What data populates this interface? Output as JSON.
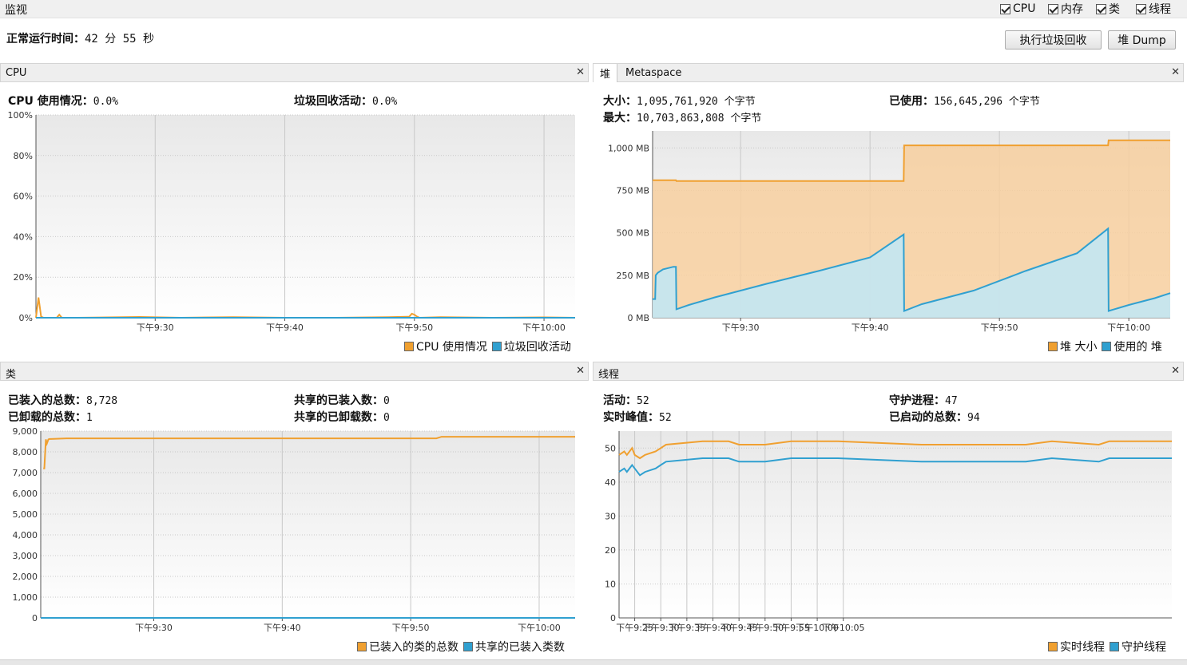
{
  "window": {
    "title": "监视"
  },
  "checkboxes": [
    {
      "label": "CPU",
      "checked": true
    },
    {
      "label": "内存",
      "checked": true
    },
    {
      "label": "类",
      "checked": true
    },
    {
      "label": "线程",
      "checked": true
    }
  ],
  "uptime": {
    "label": "正常运行时间：",
    "value": "42 分 55 秒"
  },
  "buttons": {
    "gc": "执行垃圾回收",
    "heap_dump": "堆 Dump"
  },
  "colors": {
    "orange": "#f0a030",
    "blue": "#30a0d0",
    "panel_bg": "#f5f5f5"
  },
  "panels": {
    "cpu": {
      "title": "CPU",
      "stats": [
        {
          "label": "CPU 使用情况：",
          "value": "0.0%"
        },
        {
          "label": "垃圾回收活动：",
          "value": "0.0%"
        }
      ],
      "legend": [
        "CPU 使用情况",
        "垃圾回收活动"
      ]
    },
    "memory": {
      "tabs": [
        "堆",
        "Metaspace"
      ],
      "stats": [
        {
          "label": "大小：",
          "value": "1,095,761,920 个字节"
        },
        {
          "label": "已使用：",
          "value": "156,645,296 个字节"
        },
        {
          "label": "最大：",
          "value": "10,703,863,808 个字节"
        }
      ],
      "legend": [
        "堆 大小",
        "使用的 堆"
      ]
    },
    "classes": {
      "title": "类",
      "stats": [
        {
          "label": "已装入的总数：",
          "value": "8,728"
        },
        {
          "label": "共享的已装入数：",
          "value": "0"
        },
        {
          "label": "已卸载的总数：",
          "value": "1"
        },
        {
          "label": "共享的已卸载数：",
          "value": "0"
        }
      ],
      "legend": [
        "已装入的类的总数",
        "共享的已装入类数"
      ]
    },
    "threads": {
      "title": "线程",
      "stats": [
        {
          "label": "活动：",
          "value": "52"
        },
        {
          "label": "守护进程：",
          "value": "47"
        },
        {
          "label": "实时峰值：",
          "value": "52"
        },
        {
          "label": "已启动的总数：",
          "value": "94"
        }
      ],
      "legend": [
        "实时线程",
        "守护线程"
      ]
    }
  },
  "chart_data": [
    {
      "id": "cpu",
      "type": "line",
      "xlim": [
        24.2,
        34.6
      ],
      "ylim": [
        0,
        100
      ],
      "yticks": [
        0,
        20,
        40,
        60,
        80,
        100
      ],
      "ytick_labels": [
        "0%",
        "20%",
        "40%",
        "60%",
        "80%",
        "100%"
      ],
      "xticks": [
        26.5,
        29,
        31.5,
        34
      ],
      "xtick_labels": [
        "下午9:30",
        "下午9:40",
        "下午9:50",
        "下午10:00"
      ],
      "series": [
        {
          "name": "CPU 使用情况",
          "color": "#f0a030",
          "x": [
            24.2,
            24.25,
            24.3,
            24.35,
            24.4,
            24.6,
            24.65,
            24.7,
            25,
            26.2,
            27,
            28,
            29,
            30,
            31,
            31.4,
            31.45,
            31.5,
            31.55,
            31.6,
            32,
            33,
            34,
            34.6
          ],
          "y": [
            0,
            10,
            0.5,
            0,
            0,
            0,
            1.5,
            0,
            0,
            0.4,
            0,
            0.3,
            0,
            0,
            0.3,
            0.5,
            2,
            1.5,
            0.6,
            0,
            0.3,
            0,
            0.2,
            0
          ]
        },
        {
          "name": "垃圾回收活动",
          "color": "#30a0d0",
          "x": [
            24.2,
            34.6
          ],
          "y": [
            0,
            0
          ]
        }
      ]
    },
    {
      "id": "heap",
      "type": "area",
      "xlim": [
        24.8,
        34.8
      ],
      "ylim": [
        0,
        1100
      ],
      "yticks": [
        0,
        250,
        500,
        750,
        1000
      ],
      "ytick_labels": [
        "0 MB",
        "250 MB",
        "500 MB",
        "750 MB",
        "1,000 MB"
      ],
      "xticks": [
        26.5,
        29,
        31.5,
        34
      ],
      "xtick_labels": [
        "下午9:30",
        "下午9:40",
        "下午9:50",
        "下午10:00"
      ],
      "series": [
        {
          "name": "堆 大小",
          "color": "#f0a030",
          "x": [
            24.8,
            25.25,
            25.26,
            29.65,
            29.66,
            33.6,
            33.61,
            34.8
          ],
          "y": [
            810,
            810,
            805,
            805,
            1015,
            1015,
            1045,
            1045
          ]
        },
        {
          "name": "使用的 堆",
          "color": "#30a0d0",
          "x": [
            24.8,
            24.85,
            24.86,
            24.9,
            25.0,
            25.2,
            25.25,
            25.26,
            25.5,
            26,
            27,
            28,
            29,
            29.65,
            29.66,
            30,
            31,
            32,
            33,
            33.6,
            33.61,
            34,
            34.5,
            34.8
          ],
          "y": [
            110,
            110,
            250,
            265,
            285,
            300,
            300,
            50,
            75,
            120,
            200,
            275,
            355,
            490,
            40,
            80,
            160,
            275,
            380,
            525,
            40,
            75,
            115,
            145
          ]
        }
      ]
    },
    {
      "id": "classes",
      "type": "line",
      "xlim": [
        24.3,
        34.7
      ],
      "ylim": [
        0,
        9000
      ],
      "yticks": [
        0,
        1000,
        2000,
        3000,
        4000,
        5000,
        6000,
        7000,
        8000,
        9000
      ],
      "ytick_labels": [
        "0",
        "1,000",
        "2,000",
        "3,000",
        "4,000",
        "5,000",
        "6,000",
        "7,000",
        "8,000",
        "9,000"
      ],
      "xticks": [
        26.5,
        29,
        31.5,
        34
      ],
      "xtick_labels": [
        "下午9:30",
        "下午9:40",
        "下午9:50",
        "下午10:00"
      ],
      "series": [
        {
          "name": "已装入的类的总数",
          "color": "#f0a030",
          "x": [
            24.35,
            24.37,
            24.4,
            24.42,
            24.45,
            24.47,
            24.5,
            24.7,
            24.8,
            32.0,
            32.1,
            34.7
          ],
          "y": [
            7200,
            7200,
            8600,
            8400,
            8600,
            8620,
            8620,
            8640,
            8650,
            8650,
            8728,
            8728
          ]
        },
        {
          "name": "共享的已装入类数",
          "color": "#30a0d0",
          "x": [
            24.3,
            34.7
          ],
          "y": [
            0,
            0
          ]
        }
      ]
    },
    {
      "id": "threads",
      "type": "line",
      "xlim": [
        24.2,
        34.8
      ],
      "ylim": [
        0,
        55
      ],
      "yticks": [
        0,
        10,
        20,
        30,
        40,
        50
      ],
      "ytick_labels": [
        "0",
        "10",
        "20",
        "30",
        "40",
        "50"
      ],
      "xticks": [
        24.5,
        25,
        25.5,
        26,
        26.5,
        27,
        27.5,
        28,
        28.5,
        29,
        29.5,
        30
      ],
      "xtick_labels": [
        "下午9:25",
        "下午9:30",
        "下午9:35",
        "下午9:40",
        "下午9:45",
        "下午9:50",
        "下午9:55",
        "下午10:00",
        "下午10:05"
      ],
      "series": [
        {
          "name": "实时线程",
          "color": "#f0a030",
          "x": [
            24.2,
            24.3,
            24.35,
            24.45,
            24.5,
            24.6,
            24.7,
            24.9,
            25.0,
            25.1,
            25.8,
            26.3,
            26.5,
            27.0,
            27.5,
            27.7,
            28.4,
            30.0,
            30.5,
            32.0,
            32.5,
            33.4,
            33.6,
            34.8
          ],
          "y": [
            48,
            49,
            48,
            50,
            48,
            47,
            48,
            49,
            50,
            51,
            52,
            52,
            51,
            51,
            52,
            52,
            52,
            51,
            51,
            51,
            52,
            51,
            52,
            52
          ]
        },
        {
          "name": "守护线程",
          "color": "#30a0d0",
          "x": [
            24.2,
            24.3,
            24.35,
            24.45,
            24.5,
            24.6,
            24.7,
            24.9,
            25.0,
            25.1,
            25.8,
            26.3,
            26.5,
            27.0,
            27.5,
            27.7,
            28.4,
            30.0,
            30.5,
            32.0,
            32.5,
            33.4,
            33.6,
            34.8
          ],
          "y": [
            43,
            44,
            43,
            45,
            44,
            42,
            43,
            44,
            45,
            46,
            47,
            47,
            46,
            46,
            47,
            47,
            47,
            46,
            46,
            46,
            47,
            46,
            47,
            47
          ]
        }
      ]
    }
  ]
}
